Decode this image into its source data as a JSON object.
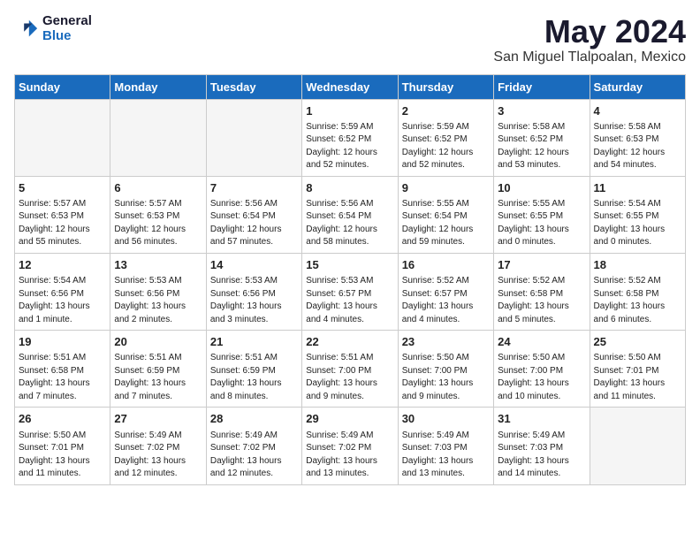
{
  "logo": {
    "general": "General",
    "blue": "Blue"
  },
  "title": "May 2024",
  "location": "San Miguel Tlalpoalan, Mexico",
  "days_of_week": [
    "Sunday",
    "Monday",
    "Tuesday",
    "Wednesday",
    "Thursday",
    "Friday",
    "Saturday"
  ],
  "weeks": [
    [
      {
        "day": "",
        "info": ""
      },
      {
        "day": "",
        "info": ""
      },
      {
        "day": "",
        "info": ""
      },
      {
        "day": "1",
        "info": "Sunrise: 5:59 AM\nSunset: 6:52 PM\nDaylight: 12 hours\nand 52 minutes."
      },
      {
        "day": "2",
        "info": "Sunrise: 5:59 AM\nSunset: 6:52 PM\nDaylight: 12 hours\nand 52 minutes."
      },
      {
        "day": "3",
        "info": "Sunrise: 5:58 AM\nSunset: 6:52 PM\nDaylight: 12 hours\nand 53 minutes."
      },
      {
        "day": "4",
        "info": "Sunrise: 5:58 AM\nSunset: 6:53 PM\nDaylight: 12 hours\nand 54 minutes."
      }
    ],
    [
      {
        "day": "5",
        "info": "Sunrise: 5:57 AM\nSunset: 6:53 PM\nDaylight: 12 hours\nand 55 minutes."
      },
      {
        "day": "6",
        "info": "Sunrise: 5:57 AM\nSunset: 6:53 PM\nDaylight: 12 hours\nand 56 minutes."
      },
      {
        "day": "7",
        "info": "Sunrise: 5:56 AM\nSunset: 6:54 PM\nDaylight: 12 hours\nand 57 minutes."
      },
      {
        "day": "8",
        "info": "Sunrise: 5:56 AM\nSunset: 6:54 PM\nDaylight: 12 hours\nand 58 minutes."
      },
      {
        "day": "9",
        "info": "Sunrise: 5:55 AM\nSunset: 6:54 PM\nDaylight: 12 hours\nand 59 minutes."
      },
      {
        "day": "10",
        "info": "Sunrise: 5:55 AM\nSunset: 6:55 PM\nDaylight: 13 hours\nand 0 minutes."
      },
      {
        "day": "11",
        "info": "Sunrise: 5:54 AM\nSunset: 6:55 PM\nDaylight: 13 hours\nand 0 minutes."
      }
    ],
    [
      {
        "day": "12",
        "info": "Sunrise: 5:54 AM\nSunset: 6:56 PM\nDaylight: 13 hours\nand 1 minute."
      },
      {
        "day": "13",
        "info": "Sunrise: 5:53 AM\nSunset: 6:56 PM\nDaylight: 13 hours\nand 2 minutes."
      },
      {
        "day": "14",
        "info": "Sunrise: 5:53 AM\nSunset: 6:56 PM\nDaylight: 13 hours\nand 3 minutes."
      },
      {
        "day": "15",
        "info": "Sunrise: 5:53 AM\nSunset: 6:57 PM\nDaylight: 13 hours\nand 4 minutes."
      },
      {
        "day": "16",
        "info": "Sunrise: 5:52 AM\nSunset: 6:57 PM\nDaylight: 13 hours\nand 4 minutes."
      },
      {
        "day": "17",
        "info": "Sunrise: 5:52 AM\nSunset: 6:58 PM\nDaylight: 13 hours\nand 5 minutes."
      },
      {
        "day": "18",
        "info": "Sunrise: 5:52 AM\nSunset: 6:58 PM\nDaylight: 13 hours\nand 6 minutes."
      }
    ],
    [
      {
        "day": "19",
        "info": "Sunrise: 5:51 AM\nSunset: 6:58 PM\nDaylight: 13 hours\nand 7 minutes."
      },
      {
        "day": "20",
        "info": "Sunrise: 5:51 AM\nSunset: 6:59 PM\nDaylight: 13 hours\nand 7 minutes."
      },
      {
        "day": "21",
        "info": "Sunrise: 5:51 AM\nSunset: 6:59 PM\nDaylight: 13 hours\nand 8 minutes."
      },
      {
        "day": "22",
        "info": "Sunrise: 5:51 AM\nSunset: 7:00 PM\nDaylight: 13 hours\nand 9 minutes."
      },
      {
        "day": "23",
        "info": "Sunrise: 5:50 AM\nSunset: 7:00 PM\nDaylight: 13 hours\nand 9 minutes."
      },
      {
        "day": "24",
        "info": "Sunrise: 5:50 AM\nSunset: 7:00 PM\nDaylight: 13 hours\nand 10 minutes."
      },
      {
        "day": "25",
        "info": "Sunrise: 5:50 AM\nSunset: 7:01 PM\nDaylight: 13 hours\nand 11 minutes."
      }
    ],
    [
      {
        "day": "26",
        "info": "Sunrise: 5:50 AM\nSunset: 7:01 PM\nDaylight: 13 hours\nand 11 minutes."
      },
      {
        "day": "27",
        "info": "Sunrise: 5:49 AM\nSunset: 7:02 PM\nDaylight: 13 hours\nand 12 minutes."
      },
      {
        "day": "28",
        "info": "Sunrise: 5:49 AM\nSunset: 7:02 PM\nDaylight: 13 hours\nand 12 minutes."
      },
      {
        "day": "29",
        "info": "Sunrise: 5:49 AM\nSunset: 7:02 PM\nDaylight: 13 hours\nand 13 minutes."
      },
      {
        "day": "30",
        "info": "Sunrise: 5:49 AM\nSunset: 7:03 PM\nDaylight: 13 hours\nand 13 minutes."
      },
      {
        "day": "31",
        "info": "Sunrise: 5:49 AM\nSunset: 7:03 PM\nDaylight: 13 hours\nand 14 minutes."
      },
      {
        "day": "",
        "info": ""
      }
    ]
  ]
}
